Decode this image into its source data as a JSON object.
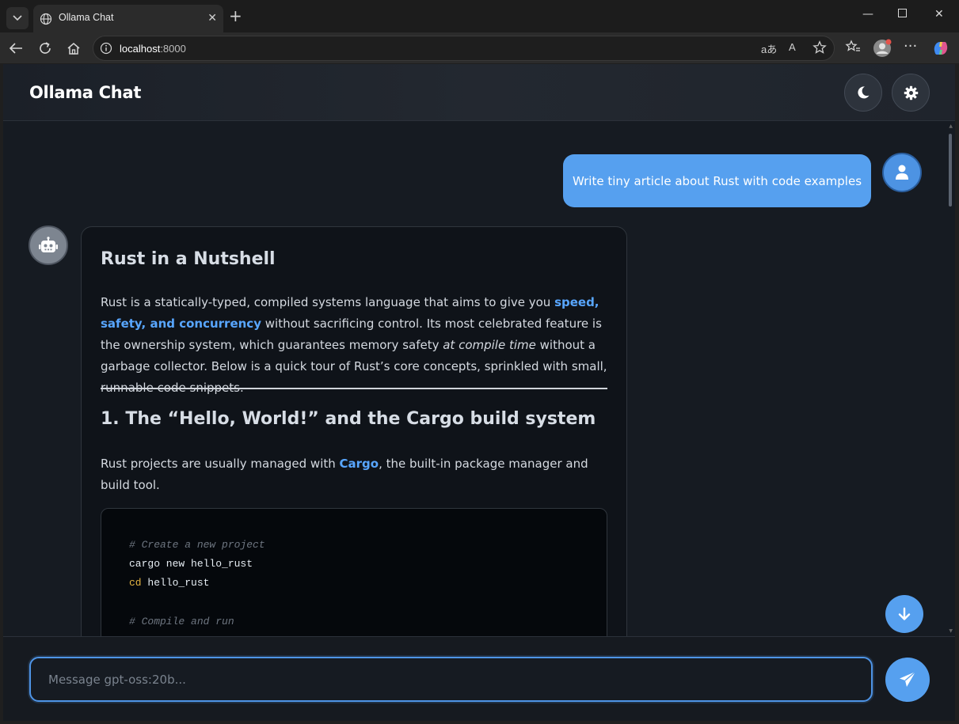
{
  "browser": {
    "tab_title": "Ollama Chat",
    "url_host": "localhost",
    "url_port": ":8000",
    "read_aloud_label": "A",
    "translate_label": "aあ"
  },
  "app": {
    "title": "Ollama Chat"
  },
  "messages": {
    "user_text": "Write tiny article about Rust with code examples",
    "bot": {
      "heading": "Rust in a Nutshell",
      "intro_1": "Rust is a statically-typed, compiled systems language that aims to give you ",
      "intro_hl": "speed, safety, and concurrency",
      "intro_2": " without sacrificing control. Its most celebrated feature is the ownership system, which guarantees memory safety ",
      "intro_em": "at compile time",
      "intro_3": " without a garbage collector. Below is a quick tour of Rust’s core concepts, sprinkled with small, runnable code snippets.",
      "section_heading": "1. The “Hello, World!” and the Cargo build system",
      "section_1": "Rust projects are usually managed with ",
      "section_hl": "Cargo",
      "section_2": ", the built-in package manager and build tool.",
      "code": {
        "line1": "# Create a new project",
        "line2": "cargo new hello_rust",
        "line3_kw": "cd",
        "line3_rest": " hello_rust",
        "line4": "# Compile and run"
      }
    }
  },
  "composer": {
    "placeholder": "Message gpt-oss:20b..."
  }
}
